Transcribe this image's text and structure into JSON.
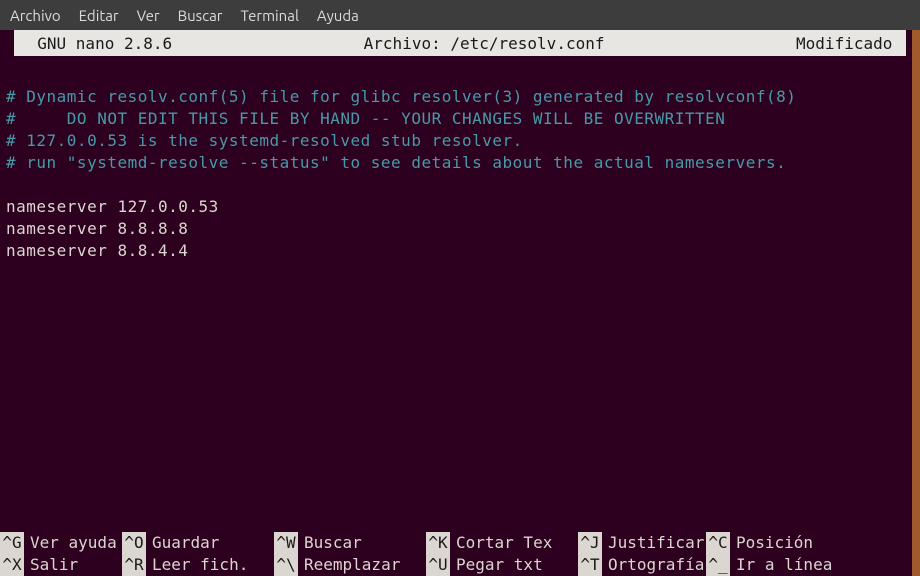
{
  "menubar": {
    "items": [
      {
        "label": "Archivo"
      },
      {
        "label": "Editar"
      },
      {
        "label": "Ver"
      },
      {
        "label": "Buscar"
      },
      {
        "label": "Terminal"
      },
      {
        "label": "Ayuda"
      }
    ]
  },
  "titlebar": {
    "left": "  GNU nano 2.8.6",
    "center": "Archivo: /etc/resolv.conf",
    "right": "Modificado "
  },
  "editor": {
    "comment_lines": [
      "# Dynamic resolv.conf(5) file for glibc resolver(3) generated by resolvconf(8)",
      "#     DO NOT EDIT THIS FILE BY HAND -- YOUR CHANGES WILL BE OVERWRITTEN",
      "# 127.0.0.53 is the systemd-resolved stub resolver.",
      "# run \"systemd-resolve --status\" to see details about the actual nameservers."
    ],
    "content_lines": [
      "nameserver 127.0.0.53",
      "nameserver 8.8.8.8",
      "nameserver 8.8.4.4"
    ]
  },
  "shortcuts": {
    "row1": [
      {
        "key": "^G",
        "label": "Ver ayuda"
      },
      {
        "key": "^O",
        "label": "Guardar"
      },
      {
        "key": "^W",
        "label": "Buscar"
      },
      {
        "key": "^K",
        "label": "Cortar Tex"
      },
      {
        "key": "^J",
        "label": "Justificar"
      },
      {
        "key": "^C",
        "label": "Posición"
      }
    ],
    "row2": [
      {
        "key": "^X",
        "label": "Salir"
      },
      {
        "key": "^R",
        "label": "Leer fich."
      },
      {
        "key": "^\\",
        "label": "Reemplazar"
      },
      {
        "key": "^U",
        "label": "Pegar txt"
      },
      {
        "key": "^T",
        "label": "Ortografía"
      },
      {
        "key": "^_",
        "label": "Ir a línea"
      }
    ]
  }
}
